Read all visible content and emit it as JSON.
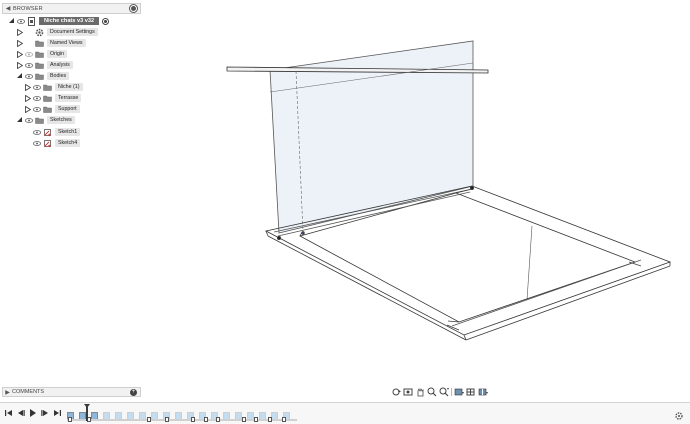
{
  "browser": {
    "title": "BROWSER",
    "root": {
      "label": "Niche chats v3 v32"
    },
    "items": [
      {
        "label": "Document Settings",
        "icon": "gear-icon"
      },
      {
        "label": "Named Views",
        "icon": "folder-icon"
      },
      {
        "label": "Origin",
        "icon": "folder-icon"
      },
      {
        "label": "Analysis",
        "icon": "folder-icon"
      },
      {
        "label": "Bodies",
        "icon": "folder-icon"
      },
      {
        "label": "Niche (1)",
        "icon": "folder-icon"
      },
      {
        "label": "Terrasse",
        "icon": "folder-icon"
      },
      {
        "label": "Support",
        "icon": "folder-icon"
      },
      {
        "label": "Sketches",
        "icon": "folder-icon"
      },
      {
        "label": "Sketch1",
        "icon": "sketch-icon"
      },
      {
        "label": "Sketch4",
        "icon": "sketch-icon"
      }
    ]
  },
  "comments": {
    "title": "COMMENTS"
  },
  "navbar": {
    "tools": [
      "orbit-icon",
      "look-at-icon",
      "pan-icon",
      "zoom-icon",
      "fit-icon",
      "display-settings-icon",
      "grid-icon",
      "viewports-icon"
    ]
  },
  "timeline": {
    "controls": [
      "skip-to-start-icon",
      "step-back-icon",
      "play-icon",
      "step-forward-icon",
      "skip-to-end-icon"
    ]
  },
  "colors": {
    "accent": "#6b6b6b",
    "sketch_red": "#d23a3a",
    "folder": "#8a8a8a",
    "timeline_blue": "#8db6d8"
  }
}
